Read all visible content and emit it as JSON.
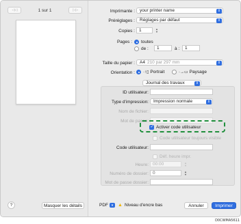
{
  "pager": {
    "prev": "◁◁",
    "label": "1 sur 1",
    "next": "▷▷"
  },
  "printer": {
    "label": "Imprimante :",
    "value": "your printer name"
  },
  "presets": {
    "label": "Préréglages :",
    "value": "Réglages par défaut"
  },
  "copies": {
    "label": "Copies :",
    "value": "1"
  },
  "pages": {
    "label": "Pages :",
    "all_label": "toutes",
    "from_label": "de :",
    "from_value": "1",
    "to_label": "à :",
    "to_value": "1"
  },
  "paper": {
    "label": "Taille du papier :",
    "value": "A4",
    "size_hint": "210 par 297 mm"
  },
  "orientation": {
    "label": "Orientation :",
    "portrait": "Portrait",
    "landscape": "Paysage"
  },
  "section": {
    "value": "Journal des travaux"
  },
  "job_log": {
    "user_id_label": "ID utilisateur:",
    "print_type_label": "Type d'impression:",
    "print_type_value": "Impression normale",
    "file_name_label": "Nom de fichier:",
    "password_label": "Mot de passe:",
    "enable_user_code_label": "Activer code utilisateur",
    "always_show_user_code_label": "Code utilisateur toujours visible",
    "user_code_label": "Code utilisateur:",
    "set_print_time_label": "Déf. heure impr.",
    "time_label": "Heure:",
    "time_value": "00:00",
    "folder_number_label": "Numéro de dossier:",
    "folder_number_value": "0",
    "folder_password_label": "Mot de passe dossier:"
  },
  "footer": {
    "help": "?",
    "hide_details": "Masquer les détails",
    "pdf": "PDF",
    "warning": "Niveau d'encre bas",
    "cancel": "Annuler",
    "print": "Imprimer"
  },
  "figure_code": "D0CWMA5611"
}
